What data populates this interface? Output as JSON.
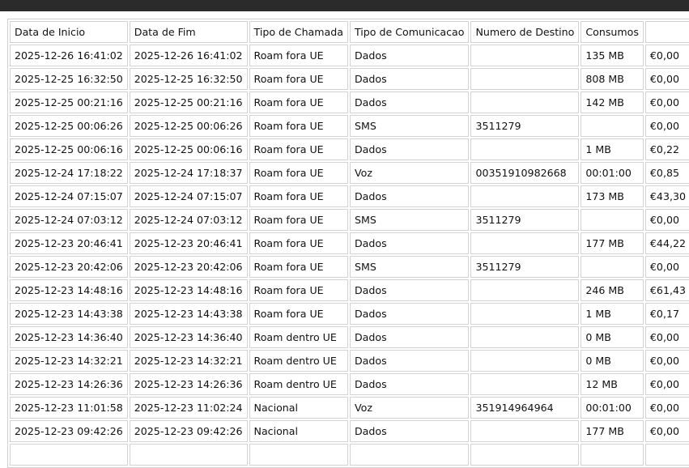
{
  "table": {
    "headers": [
      "Data de Inicio",
      "Data de Fim",
      "Tipo de Chamada",
      "Tipo de Comunicacao",
      "Numero de Destino",
      "Consumos",
      ""
    ],
    "rows": [
      [
        "2025-12-26 16:41:02",
        "2025-12-26 16:41:02",
        "Roam fora UE",
        "Dados",
        "",
        "135 MB",
        "€0,00"
      ],
      [
        "2025-12-25 16:32:50",
        "2025-12-25 16:32:50",
        "Roam fora UE",
        "Dados",
        "",
        "808 MB",
        "€0,00"
      ],
      [
        "2025-12-25 00:21:16",
        "2025-12-25 00:21:16",
        "Roam fora UE",
        "Dados",
        "",
        "142 MB",
        "€0,00"
      ],
      [
        "2025-12-25 00:06:26",
        "2025-12-25 00:06:26",
        "Roam fora UE",
        "SMS",
        "3511279",
        "",
        "€0,00"
      ],
      [
        "2025-12-25 00:06:16",
        "2025-12-25 00:06:16",
        "Roam fora UE",
        "Dados",
        "",
        "1 MB",
        "€0,22"
      ],
      [
        "2025-12-24 17:18:22",
        "2025-12-24 17:18:37",
        "Roam fora UE",
        "Voz",
        "00351910982668",
        "00:01:00",
        "€0,85"
      ],
      [
        "2025-12-24 07:15:07",
        "2025-12-24 07:15:07",
        "Roam fora UE",
        "Dados",
        "",
        "173 MB",
        "€43,30"
      ],
      [
        "2025-12-24 07:03:12",
        "2025-12-24 07:03:12",
        "Roam fora UE",
        "SMS",
        "3511279",
        "",
        "€0,00"
      ],
      [
        "2025-12-23 20:46:41",
        "2025-12-23 20:46:41",
        "Roam fora UE",
        "Dados",
        "",
        "177 MB",
        "€44,22"
      ],
      [
        "2025-12-23 20:42:06",
        "2025-12-23 20:42:06",
        "Roam fora UE",
        "SMS",
        "3511279",
        "",
        "€0,00"
      ],
      [
        "2025-12-23 14:48:16",
        "2025-12-23 14:48:16",
        "Roam fora UE",
        "Dados",
        "",
        "246 MB",
        "€61,43"
      ],
      [
        "2025-12-23 14:43:38",
        "2025-12-23 14:43:38",
        "Roam fora UE",
        "Dados",
        "",
        "1 MB",
        "€0,17"
      ],
      [
        "2025-12-23 14:36:40",
        "2025-12-23 14:36:40",
        "Roam dentro UE",
        "Dados",
        "",
        "0 MB",
        "€0,00"
      ],
      [
        "2025-12-23 14:32:21",
        "2025-12-23 14:32:21",
        "Roam dentro UE",
        "Dados",
        "",
        "0 MB",
        "€0,00"
      ],
      [
        "2025-12-23 14:26:36",
        "2025-12-23 14:26:36",
        "Roam dentro UE",
        "Dados",
        "",
        "12 MB",
        "€0,00"
      ],
      [
        "2025-12-23 11:01:58",
        "2025-12-23 11:02:24",
        "Nacional",
        "Voz",
        "351914964964",
        "00:01:00",
        "€0,00"
      ],
      [
        "2025-12-23 09:42:26",
        "2025-12-23 09:42:26",
        "Nacional",
        "Dados",
        "",
        "177 MB",
        "€0,00"
      ],
      [
        "",
        "",
        "",
        "",
        "",
        "",
        ""
      ]
    ]
  }
}
